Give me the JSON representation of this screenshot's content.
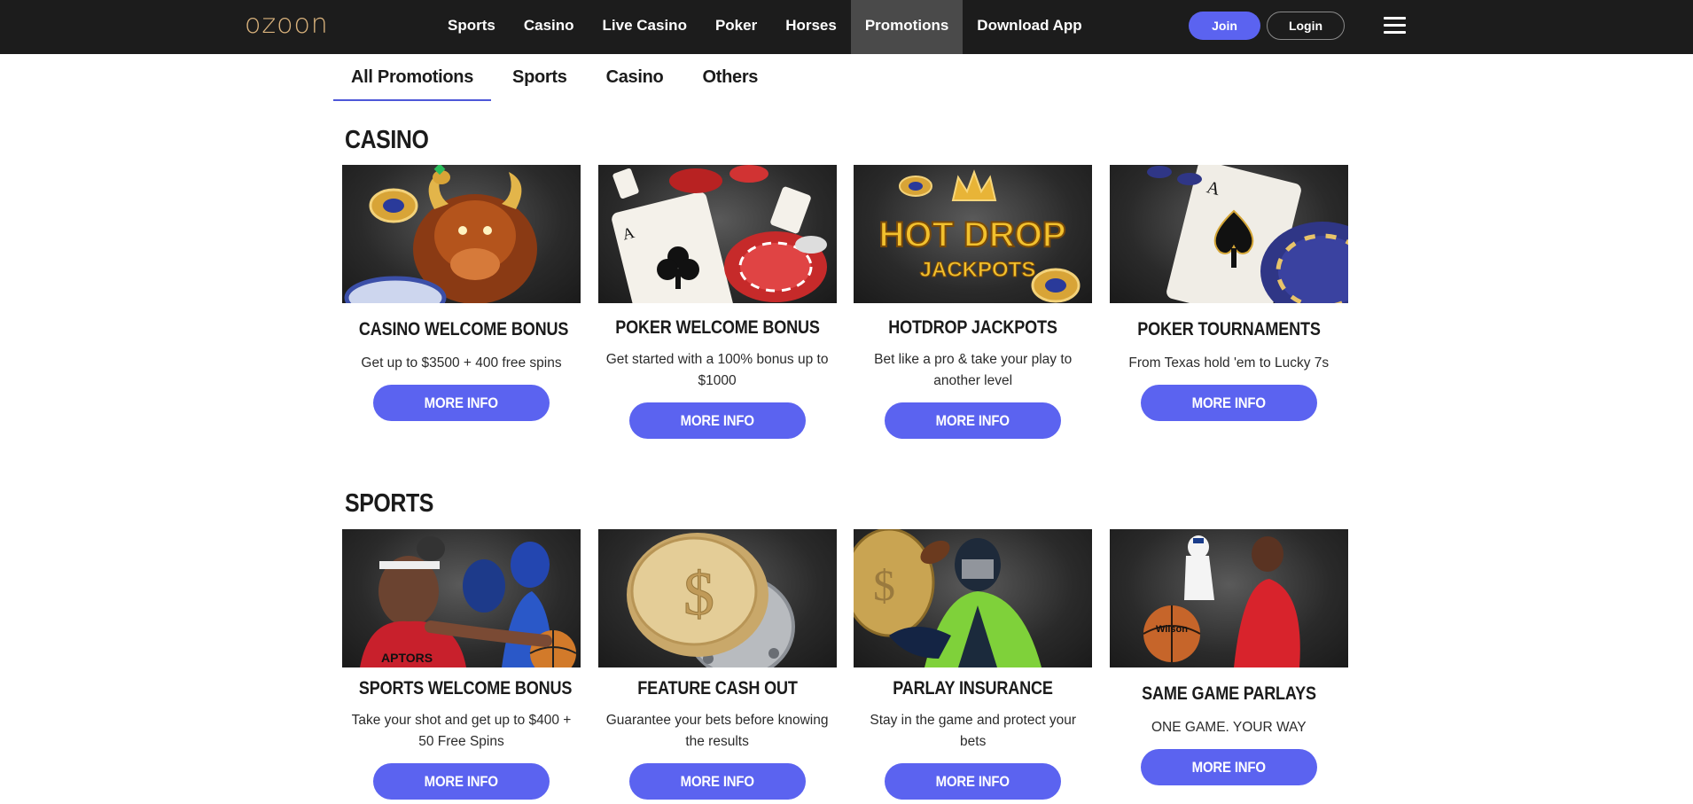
{
  "brand": {
    "logo": "ozoon",
    "logo_color": "#d9b27c"
  },
  "nav": {
    "items": [
      {
        "label": "Sports"
      },
      {
        "label": "Casino"
      },
      {
        "label": "Live Casino"
      },
      {
        "label": "Poker"
      },
      {
        "label": "Horses"
      },
      {
        "label": "Promotions",
        "active": true
      },
      {
        "label": "Download App"
      }
    ],
    "join_label": "Join",
    "login_label": "Login",
    "accent_color": "#5b63f0"
  },
  "tabs": [
    {
      "label": "All Promotions",
      "active": true
    },
    {
      "label": "Sports"
    },
    {
      "label": "Casino"
    },
    {
      "label": "Others"
    }
  ],
  "sections": [
    {
      "title": "CASINO",
      "cards": [
        {
          "title": "CASINO WELCOME BONUS",
          "description": "Get up to $3500 + 400 free spins",
          "button": "MORE INFO"
        },
        {
          "title": "POKER WELCOME BONUS",
          "description": "Get started with a 100% bonus up to $1000",
          "button": "MORE INFO"
        },
        {
          "title": "HOTDROP JACKPOTS",
          "description": "Bet like a pro & take your play to another level",
          "button": "MORE INFO",
          "image_text": [
            "HOT DROP",
            "JACKPOTS"
          ]
        },
        {
          "title": "POKER TOURNAMENTS",
          "description": "From Texas hold 'em to Lucky 7s",
          "button": "MORE INFO"
        }
      ]
    },
    {
      "title": "SPORTS",
      "cards": [
        {
          "title": "SPORTS WELCOME BONUS",
          "description": "Take your shot and get up to $400 + 50 Free Spins",
          "button": "MORE INFO"
        },
        {
          "title": "FEATURE CASH OUT",
          "description": "Guarantee your bets before knowing the results",
          "button": "MORE INFO"
        },
        {
          "title": "PARLAY INSURANCE",
          "description": "Stay in the game and protect your bets",
          "button": "MORE INFO"
        },
        {
          "title": "SAME GAME PARLAYS",
          "description": "ONE GAME. YOUR WAY",
          "button": "MORE INFO"
        }
      ]
    }
  ]
}
